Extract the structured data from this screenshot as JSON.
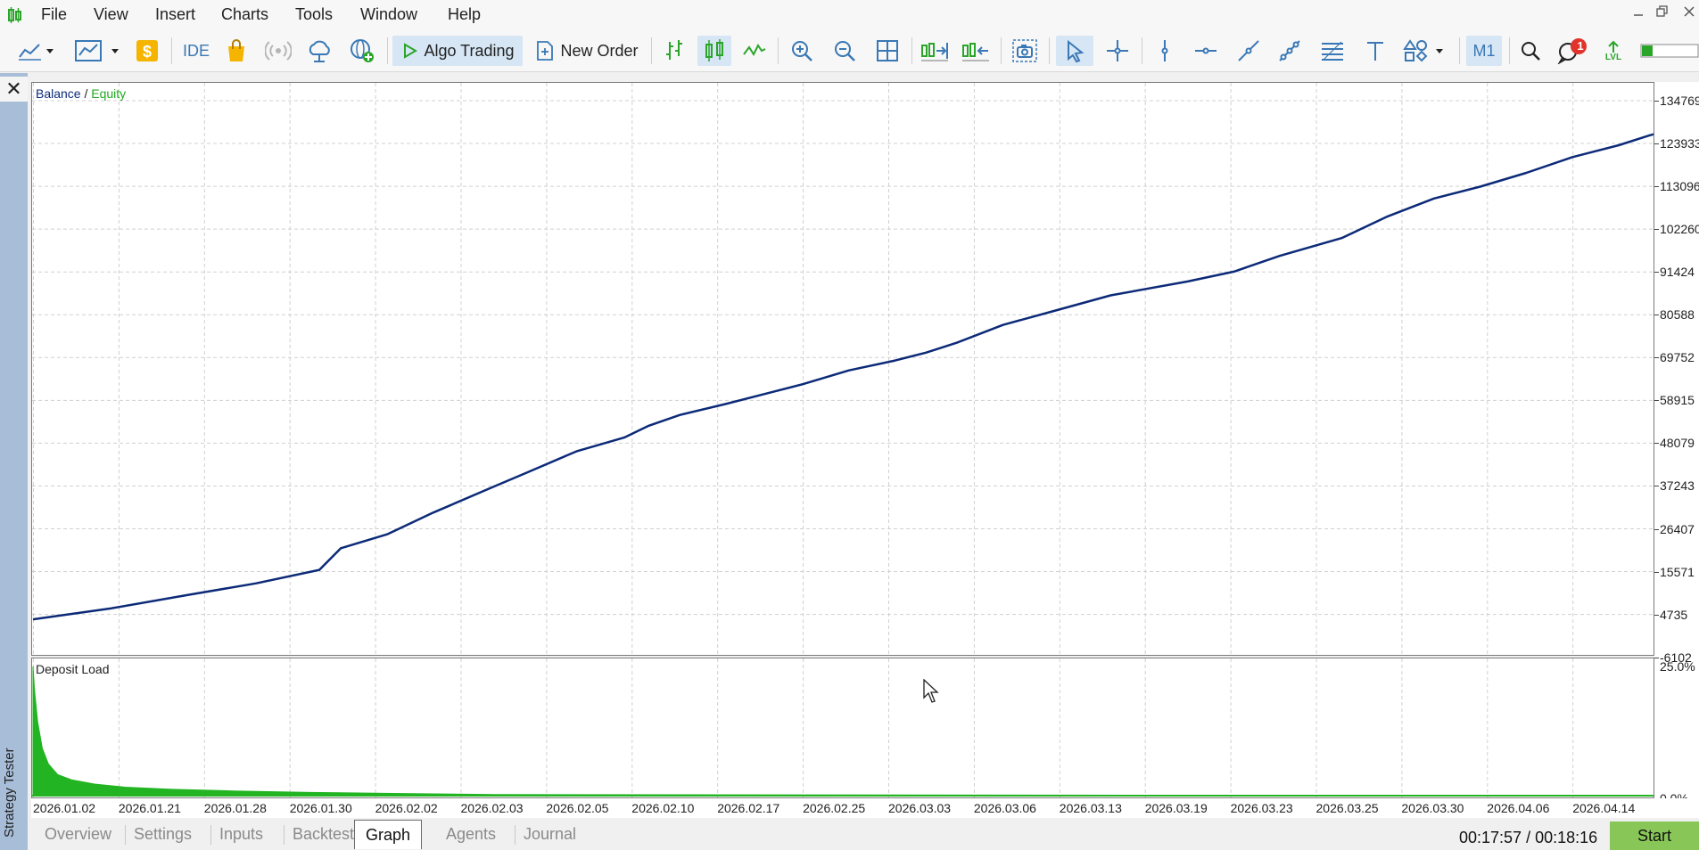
{
  "menu": [
    "File",
    "View",
    "Insert",
    "Charts",
    "Tools",
    "Window",
    "Help"
  ],
  "toolbar": {
    "ide_label": "IDE",
    "algo_trading_label": "Algo Trading",
    "new_order_label": "New Order",
    "timeframe_label": "M1",
    "notification_count": "1",
    "lvl_label": "LVL"
  },
  "side": {
    "label": "Strategy Tester",
    "close_glyph": "✕"
  },
  "colors": {
    "balance": "#0c2a78",
    "equity": "#22aa22",
    "deposit_load": "#22b422",
    "grid": "#d0d0d0",
    "side_strip": "#a7bdd8",
    "start_button": "#88c757"
  },
  "legend": {
    "balance": "Balance",
    "separator": "/",
    "equity": "Equity"
  },
  "deposit_load_title": "Deposit Load",
  "chart_data": [
    {
      "type": "line",
      "title": "Balance / Equity",
      "y_ticks": [
        "134769",
        "123933",
        "113096",
        "102260",
        "91424",
        "80588",
        "69752",
        "58915",
        "48079",
        "37243",
        "26407",
        "15571",
        "4735",
        "-6102"
      ],
      "ylim": [
        -6102,
        134769
      ],
      "x_ticks": [
        "2026.01.02",
        "2026.01.21",
        "2026.01.28",
        "2026.01.30",
        "2026.02.02",
        "2026.02.03",
        "2026.02.05",
        "2026.02.10",
        "2026.02.17",
        "2026.02.25",
        "2026.03.03",
        "2026.03.06",
        "2026.03.13",
        "2026.03.19",
        "2026.03.23",
        "2026.03.25",
        "2026.03.30",
        "2026.04.06",
        "2026.04.14"
      ],
      "grid": true,
      "legend_position": "top-left",
      "series": [
        {
          "name": "Balance",
          "color": "#0c2a78",
          "points": [
            [
              0.0,
              3500
            ],
            [
              0.051,
              6300
            ],
            [
              0.101,
              9700
            ],
            [
              0.145,
              12600
            ],
            [
              0.186,
              16000
            ],
            [
              0.2,
              21500
            ],
            [
              0.23,
              25000
            ],
            [
              0.26,
              30500
            ],
            [
              0.3,
              37200
            ],
            [
              0.32,
              40500
            ],
            [
              0.353,
              46000
            ],
            [
              0.384,
              49500
            ],
            [
              0.4,
              52500
            ],
            [
              0.42,
              55200
            ],
            [
              0.45,
              58000
            ],
            [
              0.48,
              61000
            ],
            [
              0.5,
              63000
            ],
            [
              0.53,
              66500
            ],
            [
              0.56,
              69000
            ],
            [
              0.58,
              71000
            ],
            [
              0.6,
              73500
            ],
            [
              0.63,
              78000
            ],
            [
              0.66,
              81200
            ],
            [
              0.7,
              85500
            ],
            [
              0.75,
              89000
            ],
            [
              0.78,
              91500
            ],
            [
              0.81,
              95500
            ],
            [
              0.85,
              100000
            ],
            [
              0.88,
              105500
            ],
            [
              0.91,
              110000
            ],
            [
              0.94,
              113000
            ],
            [
              0.97,
              116500
            ],
            [
              1.0,
              120500
            ],
            [
              1.03,
              123500
            ],
            [
              1.05,
              126000
            ],
            [
              1.07,
              128000
            ],
            [
              1.09,
              130000
            ],
            [
              1.12,
              132500
            ],
            [
              1.15,
              134500
            ],
            [
              1.19,
              137500
            ],
            [
              1.23,
              141000
            ],
            [
              1.27,
              144500
            ],
            [
              1.3,
              147000
            ]
          ]
        },
        {
          "name": "Equity",
          "color": "#22aa22",
          "points": []
        }
      ]
    },
    {
      "type": "area",
      "title": "Deposit Load",
      "y_ticks": [
        "25.0%",
        "0.0%"
      ],
      "ylim": [
        0,
        25
      ],
      "series": [
        {
          "name": "Deposit Load",
          "color": "#22b422",
          "points": [
            [
              0.0,
              24.5
            ],
            [
              0.001,
              20
            ],
            [
              0.003,
              14
            ],
            [
              0.006,
              9
            ],
            [
              0.01,
              6
            ],
            [
              0.016,
              4
            ],
            [
              0.025,
              3
            ],
            [
              0.04,
              2.2
            ],
            [
              0.06,
              1.6
            ],
            [
              0.09,
              1.2
            ],
            [
              0.13,
              0.9
            ],
            [
              0.18,
              0.6
            ],
            [
              0.24,
              0.4
            ],
            [
              0.3,
              0.2
            ],
            [
              1.0,
              0.0
            ]
          ]
        }
      ]
    }
  ],
  "tabs": [
    "Overview",
    "Settings",
    "Inputs",
    "Backtest",
    "Graph",
    "Agents",
    "Journal"
  ],
  "active_tab": "Graph",
  "timer": "00:17:57 / 00:18:16",
  "start_label": "Start"
}
